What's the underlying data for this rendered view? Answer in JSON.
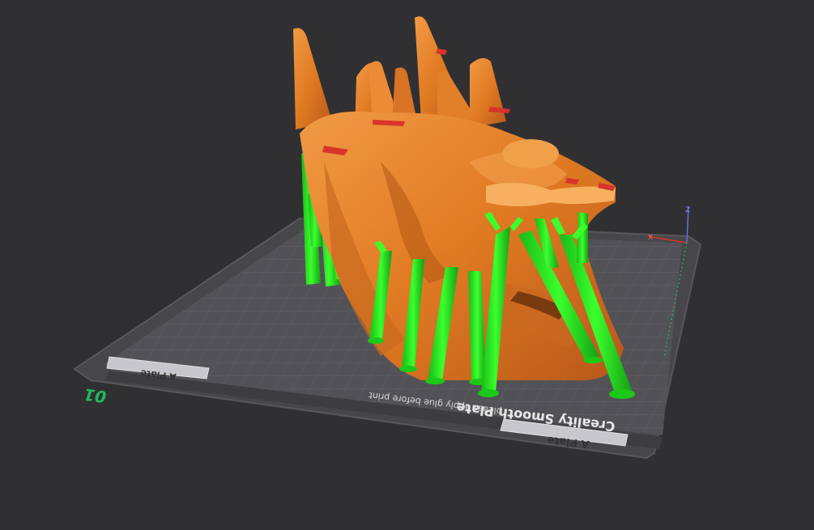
{
  "plate": {
    "number": "01",
    "brand_label": "Creality Smooth Plate",
    "glue_notice": "please apply glue before print",
    "tab_front_label": "A Plate",
    "tab_left_label": "A Plate"
  },
  "axes": {
    "z_label": "Z",
    "x_label": "X",
    "y_label": "Y"
  },
  "colors": {
    "background": "#303033",
    "plate_outer": "#4a4a4d",
    "plate_grid": "#5c5c60",
    "model": "#e8822d",
    "model_shadow": "#b85d18",
    "supports": "#22e61c",
    "plate_number": "#1fb85a",
    "accent_red": "#d8342a"
  },
  "icons": {
    "axis_gizmo": "axis-gizmo-icon"
  }
}
